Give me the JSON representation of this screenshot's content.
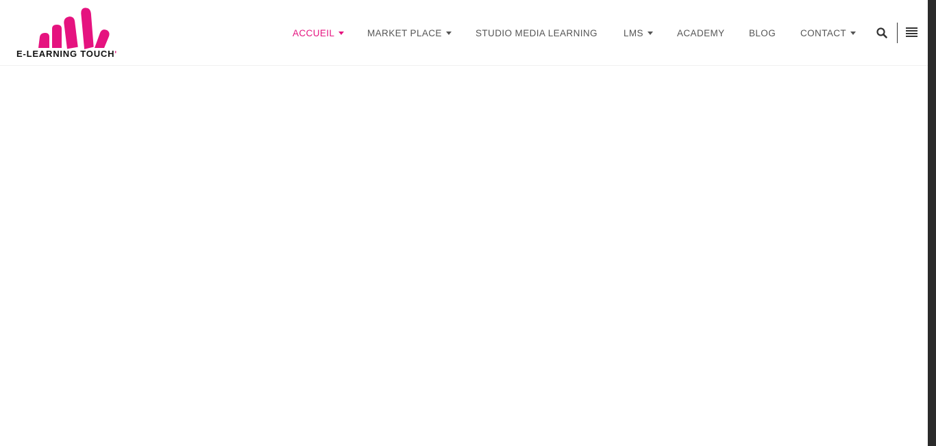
{
  "brand": {
    "name": "E-LEARNING TOUCH",
    "accent": "'",
    "primary_color": "#e5137f"
  },
  "nav": {
    "items": [
      {
        "label": "ACCUEIL",
        "active": true,
        "has_dropdown": true
      },
      {
        "label": "MARKET PLACE",
        "active": false,
        "has_dropdown": true
      },
      {
        "label": "STUDIO MEDIA LEARNING",
        "active": false,
        "has_dropdown": false
      },
      {
        "label": "LMS",
        "active": false,
        "has_dropdown": true
      },
      {
        "label": "ACADEMY",
        "active": false,
        "has_dropdown": false
      },
      {
        "label": "BLOG",
        "active": false,
        "has_dropdown": false
      },
      {
        "label": "CONTACT",
        "active": false,
        "has_dropdown": true
      }
    ]
  },
  "icons": {
    "search": "search-icon",
    "menu": "hamburger-menu-icon",
    "dropdown": "caret-down-icon"
  },
  "colors": {
    "nav_text": "#555555",
    "nav_active": "#e5137f",
    "scrollbar": "#2b2b2b"
  }
}
